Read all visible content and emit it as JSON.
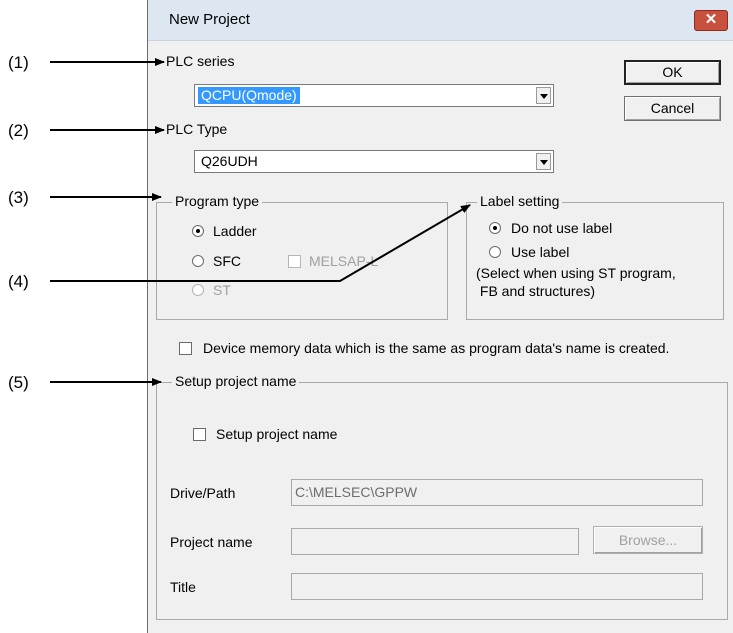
{
  "callouts": [
    "(1)",
    "(2)",
    "(3)",
    "(4)",
    "(5)"
  ],
  "window": {
    "title": "New Project",
    "close_glyph": "✕"
  },
  "plc_series": {
    "label": "PLC series",
    "value": "QCPU(Qmode)"
  },
  "plc_type": {
    "label": "PLC Type",
    "value": "Q26UDH"
  },
  "buttons": {
    "ok": "OK",
    "cancel": "Cancel",
    "browse": "Browse..."
  },
  "program_type": {
    "legend": "Program type",
    "ladder": "Ladder",
    "sfc": "SFC",
    "melsap": "MELSAP-L",
    "st": "ST",
    "selected": "Ladder"
  },
  "label_setting": {
    "legend": "Label setting",
    "no_label": "Do not use label",
    "use_label": "Use label",
    "note_line1": "(Select when using ST program,",
    "note_line2": " FB and structures)",
    "selected": "Do not use label"
  },
  "device_memory": {
    "label": "Device memory data which is the same as program data's name is created.",
    "checked": false
  },
  "setup_project": {
    "legend": "Setup project name",
    "checkbox_label": "Setup project name",
    "checked": false,
    "drive_path_label": "Drive/Path",
    "drive_path_value": "C:\\MELSEC\\GPPW",
    "project_name_label": "Project name",
    "project_name_value": "",
    "title_label": "Title",
    "title_value": ""
  },
  "colors": {
    "selection": "#3399ff",
    "close_button": "#c7503e",
    "dialog_bg": "#f0f0f0"
  }
}
